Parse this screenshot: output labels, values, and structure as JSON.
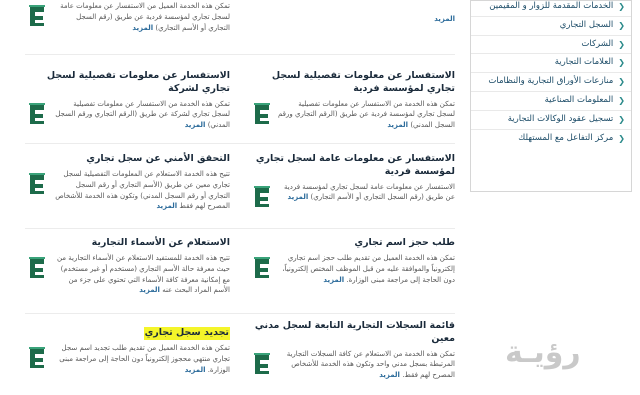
{
  "sidebar": {
    "items": [
      {
        "label": "الخدمات المقدمة للزوار و المقيمين"
      },
      {
        "label": "السجل التجاري"
      },
      {
        "label": "الشركات"
      },
      {
        "label": "العلامات التجارية"
      },
      {
        "label": "منازعات الأوراق التجارية والنظامات"
      },
      {
        "label": "المعلومات الصناعية"
      },
      {
        "label": "تسجيل عقود الوكالات التجارية"
      },
      {
        "label": "مركز التفاعل مع المستهلك"
      }
    ]
  },
  "services": [
    {
      "title": "",
      "desc": "تمكن هذه الخدمة العميل من الاستفسار عن معلومات عامة لسجل تجاري لمؤسسة فردية عن طريق (رقم السجل التجاري أو الأسم التجاري)",
      "more": "المزيد"
    },
    {
      "title": "",
      "desc": "",
      "more": "المزيد"
    },
    {
      "title": "الاستفسار عن معلومات تفصيلية لسجل تجاري لشركة",
      "desc": "تمكن هذه الخدمة من الاستفسار عن معلومات تفصيلية لسجل تجاري لشركة عن طريق (الرقم التجاري ورقم السجل المدني)",
      "more": "المزيد"
    },
    {
      "title": "الاستفسار عن معلومات تفصيلية لسجل تجاري لمؤسسة فردية",
      "desc": "تمكن هذه الخدمة من الاستفسار عن معلومات تفصيلية لسجل تجاري لمؤسسة فردية عن طريق (الرقم التجاري ورقم السجل المدني)",
      "more": "المزيد"
    },
    {
      "title": "التحقق الأمني عن سجل تجاري",
      "desc": "تتيح هذه الخدمة الاستعلام عن المعلومات التفصيلية لسجل تجاري معين عن طريق (الأسم التجاري أو رقم السجل التجاري أو رقم السجل المدني) وتكون هذه الخدمة للأشخاص المصرح لهم فقط",
      "more": "المزيد"
    },
    {
      "title": "الاستفسار عن معلومات عامة لسجل تجاري لمؤسسة فردية",
      "desc": "الاستفسار عن معلومات عامة لسجل تجاري لمؤسسة فردية عن طريق (رقم السجل التجاري أو الأسم التجاري)",
      "more": "المزيد"
    },
    {
      "title": "الاستعلام عن الأسماء التجارية",
      "desc": "تتيح هذه الخدمة للمستفيد الاستعلام عن الأسماء التجارية من حيث معرفة حالة الأسم التجاري (مستخدم أو غير مستخدم) مع إمكانية معرفة كافة الأسماء التي تحتوي على جزء من الأسم المراد البحث عنه",
      "more": "المزيد"
    },
    {
      "title": "طلب حجز اسم تجاري",
      "desc": "تمكن هذه الخدمة العميل من تقديم طلب حجز اسم تجاري إلكترونياً والموافقة عليه من قبل الموظف المختص إلكترونياً، دون الحاجة إلى مراجعة مبنى الوزارة.",
      "more": "المزيد"
    },
    {
      "title": "تجديد سجل تجاري",
      "desc": "تمكن هذه الخدمة العميل من تقديم طلب تجديد اسم سجل تجاري منتهي محجوز إلكترونياً دون الحاجة إلى مراجعة مبنى الوزارة.",
      "more": "المزيد"
    },
    {
      "title": "قائمة السجلات التجارية التابعة لسجل مدني معين",
      "desc": "تمكن هذه الخدمة من الاستعلام عن كافة السجلات التجارية المرتبطة بسجل مدني واحد وتكون هذه الخدمة للأشخاص المصرح لهم فقط.",
      "more": "المزيد"
    }
  ],
  "watermark": "رؤيـة"
}
